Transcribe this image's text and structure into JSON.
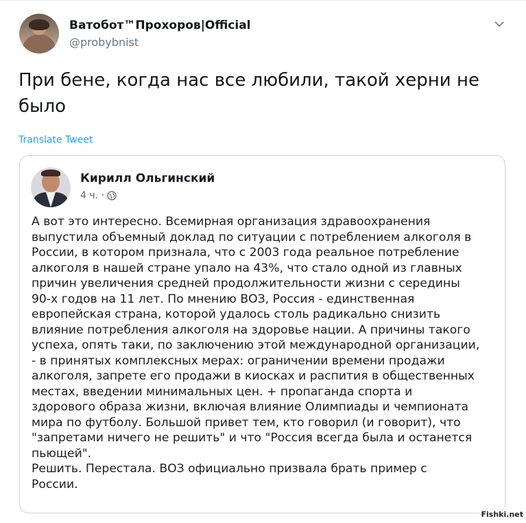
{
  "tweet": {
    "author_name": "Ватобот™Прохоров|Official",
    "author_handle": "@probybnist",
    "text": "При бене, когда нас все любили, такой херни не было",
    "translate_label": "Translate Tweet"
  },
  "embedded_post": {
    "author_name": "Кирилл Ольгинский",
    "time": "4 ч. ·",
    "lines": [
      "А вот это интересно. Всемирная организация здравоохранения",
      "выпустила объемный доклад по ситуации с потреблением алкоголя в",
      "России, в котором признала, что с 2003 года реальное потребление",
      "алкоголя в нашей стране упало на 43%, что стало одной из главных",
      "причин увеличения средней продолжительности жизни с середины",
      "90-х годов на 11 лет. По мнению ВОЗ, Россия - единственная",
      "европейская страна, которой удалось столь радикально снизить",
      "влияние потребления алкоголя на здоровье нации. А причины такого",
      "успеха, опять таки, по заключению этой международной организации,",
      "- в принятых комплексных мерах: ограничении времени продажи",
      "алкоголя, запрете его продажи в киосках и распития в общественных",
      "местах, введении минимальных цен. + пропаганда спорта и",
      "здорового образа жизни, включая влияние Олимпиады и чемпионата",
      "мира по футболу. Большой привет тем, кто говорил (и говорит), что",
      "\"запретами ничего не решить\" и что \"Россия всегда была и останется",
      "пьющей\".",
      "Решить. Перестала. ВОЗ официально призвала брать пример с",
      "России."
    ]
  },
  "watermark": "Fishki.net",
  "icons": {
    "caret": "chevron-down-icon",
    "privacy": "globe-icon"
  },
  "colors": {
    "link": "#1da1f2",
    "handle": "#657786",
    "border": "#ccd6dd"
  }
}
